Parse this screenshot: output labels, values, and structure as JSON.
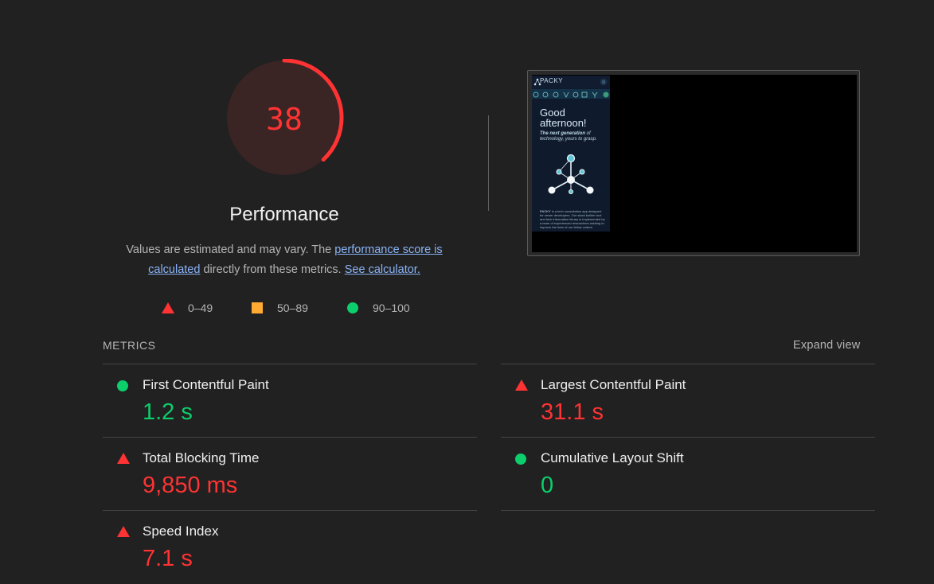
{
  "gauge": {
    "score": "38",
    "fraction": 0.38,
    "color": "#ff3333"
  },
  "category": {
    "title": "Performance"
  },
  "description": {
    "text1": "Values are estimated and may vary. The ",
    "link1": "performance score is calculated",
    "text2": " directly from these metrics. ",
    "link2": "See calculator."
  },
  "legend": [
    {
      "icon": "fail-triangle-icon",
      "label": "0–49",
      "color": "#ff3333"
    },
    {
      "icon": "average-square-icon",
      "label": "50–89",
      "color": "#ffaa33"
    },
    {
      "icon": "pass-circle-icon",
      "label": "90–100",
      "color": "#0cce6b"
    }
  ],
  "screenshot": {
    "brand": "PACKY",
    "greeting": "Good afternoon!",
    "tagline_bold": "The next generation",
    "tagline_rest": " of technology, yours to grasp.",
    "body_bold": "PACKY",
    "body_rest": " is a tech consultation app designed for newer developers. Our stack builder tool and tech information library is implemented by a team of experienced researchers wishing to improve the lives of our fellow coders."
  },
  "metrics": {
    "header": "METRICS",
    "expand_label": "Expand view",
    "items": [
      {
        "name": "First Contentful Paint",
        "value": "1.2 s",
        "status": "pass",
        "icon": "pass-circle-icon"
      },
      {
        "name": "Largest Contentful Paint",
        "value": "31.1 s",
        "status": "fail",
        "icon": "fail-triangle-icon"
      },
      {
        "name": "Total Blocking Time",
        "value": "9,850 ms",
        "status": "fail",
        "icon": "fail-triangle-icon"
      },
      {
        "name": "Cumulative Layout Shift",
        "value": "0",
        "status": "pass",
        "icon": "pass-circle-icon"
      },
      {
        "name": "Speed Index",
        "value": "7.1 s",
        "status": "fail",
        "icon": "fail-triangle-icon"
      }
    ]
  }
}
